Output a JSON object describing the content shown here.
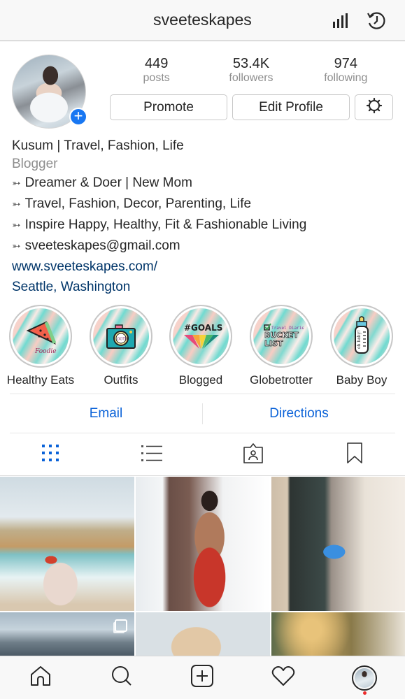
{
  "topbar": {
    "username": "sveeteskapes",
    "icons": [
      "insights-icon",
      "archive-clock-icon"
    ]
  },
  "profile": {
    "stats": [
      {
        "value": "449",
        "label": "posts"
      },
      {
        "value": "53.4K",
        "label": "followers"
      },
      {
        "value": "974",
        "label": "following"
      }
    ],
    "buttons": {
      "promote": "Promote",
      "edit_profile": "Edit Profile",
      "settings_icon": "gear-icon"
    },
    "add_story_icon": "plus-icon"
  },
  "bio": {
    "name": "Kusum | Travel, Fashion, Life",
    "category": "Blogger",
    "arrow_glyph": "➳",
    "lines": [
      "Dreamer & Doer | New Mom",
      "Travel, Fashion, Decor, Parenting, Life",
      "Inspire Happy, Healthy, Fit & Fashionable Living",
      "sveeteskapes@gmail.com"
    ],
    "website": "www.sveeteskapes.com/",
    "location": "Seattle, Washington"
  },
  "highlights": [
    {
      "label": "Healthy Eats",
      "cover": "watermelon-foodie",
      "cover_text": "Foodie"
    },
    {
      "label": "Outfits",
      "cover": "camera-ootd",
      "cover_text": "OOTD"
    },
    {
      "label": "Blogged",
      "cover": "goals-rainbow",
      "cover_text": "#GOALS"
    },
    {
      "label": "Globetrotter",
      "cover": "bucket-list",
      "cover_text": "BUCKET LIST"
    },
    {
      "label": "Baby Boy",
      "cover": "baby-bottle",
      "cover_text": "oh baby!"
    }
  ],
  "contact": {
    "email": "Email",
    "directions": "Directions"
  },
  "tabs": [
    {
      "name": "grid",
      "icon": "grid-icon",
      "active": true
    },
    {
      "name": "list",
      "icon": "list-icon",
      "active": false
    },
    {
      "name": "tagged",
      "icon": "tagged-icon",
      "active": false
    },
    {
      "name": "saved",
      "icon": "bookmark-icon",
      "active": false
    }
  ],
  "grid": [
    {
      "alt": "Couple on beach with cliff"
    },
    {
      "alt": "Woman in red dress applying lipstick"
    },
    {
      "alt": "Home office with shelves"
    },
    {
      "alt": "Glass chandelier sculpture",
      "multi": true
    },
    {
      "alt": "Sandstone rock formation"
    },
    {
      "alt": "Gold bokeh decor"
    }
  ],
  "bottom_nav": [
    {
      "name": "home",
      "icon": "home-icon"
    },
    {
      "name": "search",
      "icon": "search-icon"
    },
    {
      "name": "new-post",
      "icon": "add-post-icon"
    },
    {
      "name": "activity",
      "icon": "heart-icon"
    },
    {
      "name": "profile",
      "icon": "profile-avatar",
      "notification": true
    }
  ],
  "colors": {
    "accent_blue": "#0a62d8",
    "badge_blue": "#1877f2",
    "link_navy": "#003569",
    "secondary_text": "#8e8e8e",
    "notification_red": "#ed2c2c"
  }
}
